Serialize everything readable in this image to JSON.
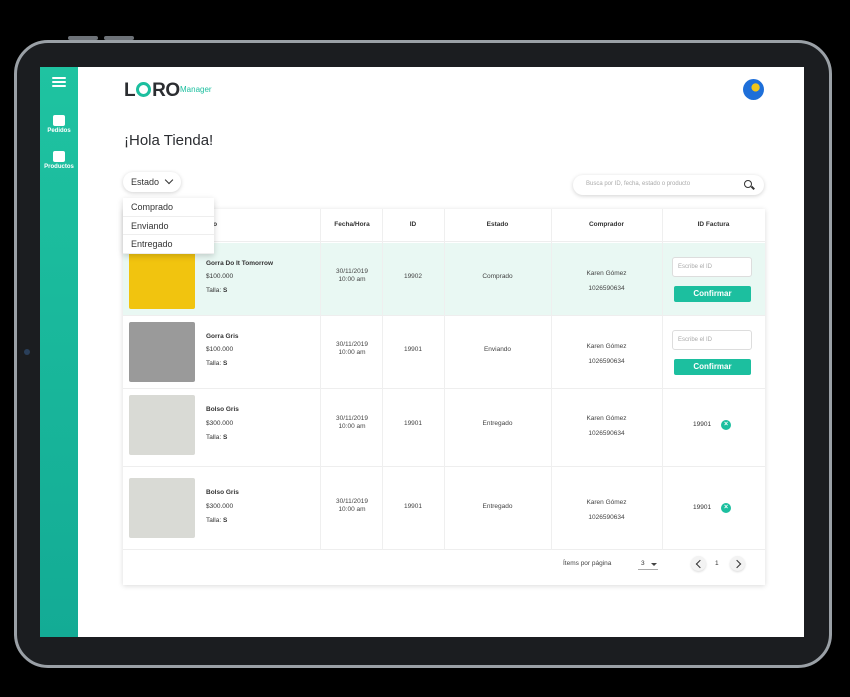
{
  "app": {
    "logo_text": "L",
    "logo_text2": "RO",
    "logo_sub": "Manager"
  },
  "sidebar": {
    "items": [
      {
        "label": "Pedidos",
        "icon": "bus-icon"
      },
      {
        "label": "Productos",
        "icon": "store-icon"
      }
    ]
  },
  "greeting": "¡Hola Tienda!",
  "filter": {
    "label": "Estado",
    "options": [
      "Comprado",
      "Enviando",
      "Entregado"
    ]
  },
  "search": {
    "placeholder": "Busca por ID, fecha, estado o producto"
  },
  "table": {
    "headers": [
      "Producto",
      "Fecha/Hora",
      "ID",
      "Estado",
      "Comprador",
      "ID Factura"
    ],
    "header_visible_product": "to",
    "rows": [
      {
        "name": "Gorra Do It Tomorrow",
        "price": "$100.000",
        "size_label": "Talla:",
        "size": "S",
        "date": "30/11/2019",
        "time": "10:00 am",
        "id": "19902",
        "status": "Comprado",
        "buyer": "Karen Gómez",
        "buyer_id": "1026590634",
        "invoice_placeholder": "Escribe el ID",
        "confirm": "Confirmar",
        "selected": true
      },
      {
        "name": "Gorra Gris",
        "price": "$100.000",
        "size_label": "Talla:",
        "size": "S",
        "date": "30/11/2019",
        "time": "10:00 am",
        "id": "19901",
        "status": "Enviando",
        "buyer": "Karen Gómez",
        "buyer_id": "1026590634",
        "invoice_placeholder": "Escribe el ID",
        "confirm": "Confirmar"
      },
      {
        "name": "Bolso Gris",
        "price": "$300.000",
        "size_label": "Talla:",
        "size": "S",
        "date": "30/11/2019",
        "time": "10:00 am",
        "id": "19901",
        "status": "Entregado",
        "buyer": "Karen Gómez",
        "buyer_id": "1026590634",
        "invoice": "19901"
      },
      {
        "name": "Bolso Gris",
        "price": "$300.000",
        "size_label": "Talla:",
        "size": "S",
        "date": "30/11/2019",
        "time": "10:00 am",
        "id": "19901",
        "status": "Entregado",
        "buyer": "Karen Gómez",
        "buyer_id": "1026590634",
        "invoice": "19901"
      }
    ]
  },
  "pagination": {
    "items_label": "Ítems por página",
    "items_value": "3",
    "page": "1"
  },
  "colors": {
    "accent": "#1cbf9f",
    "selected_row": "#e9f8f3"
  }
}
